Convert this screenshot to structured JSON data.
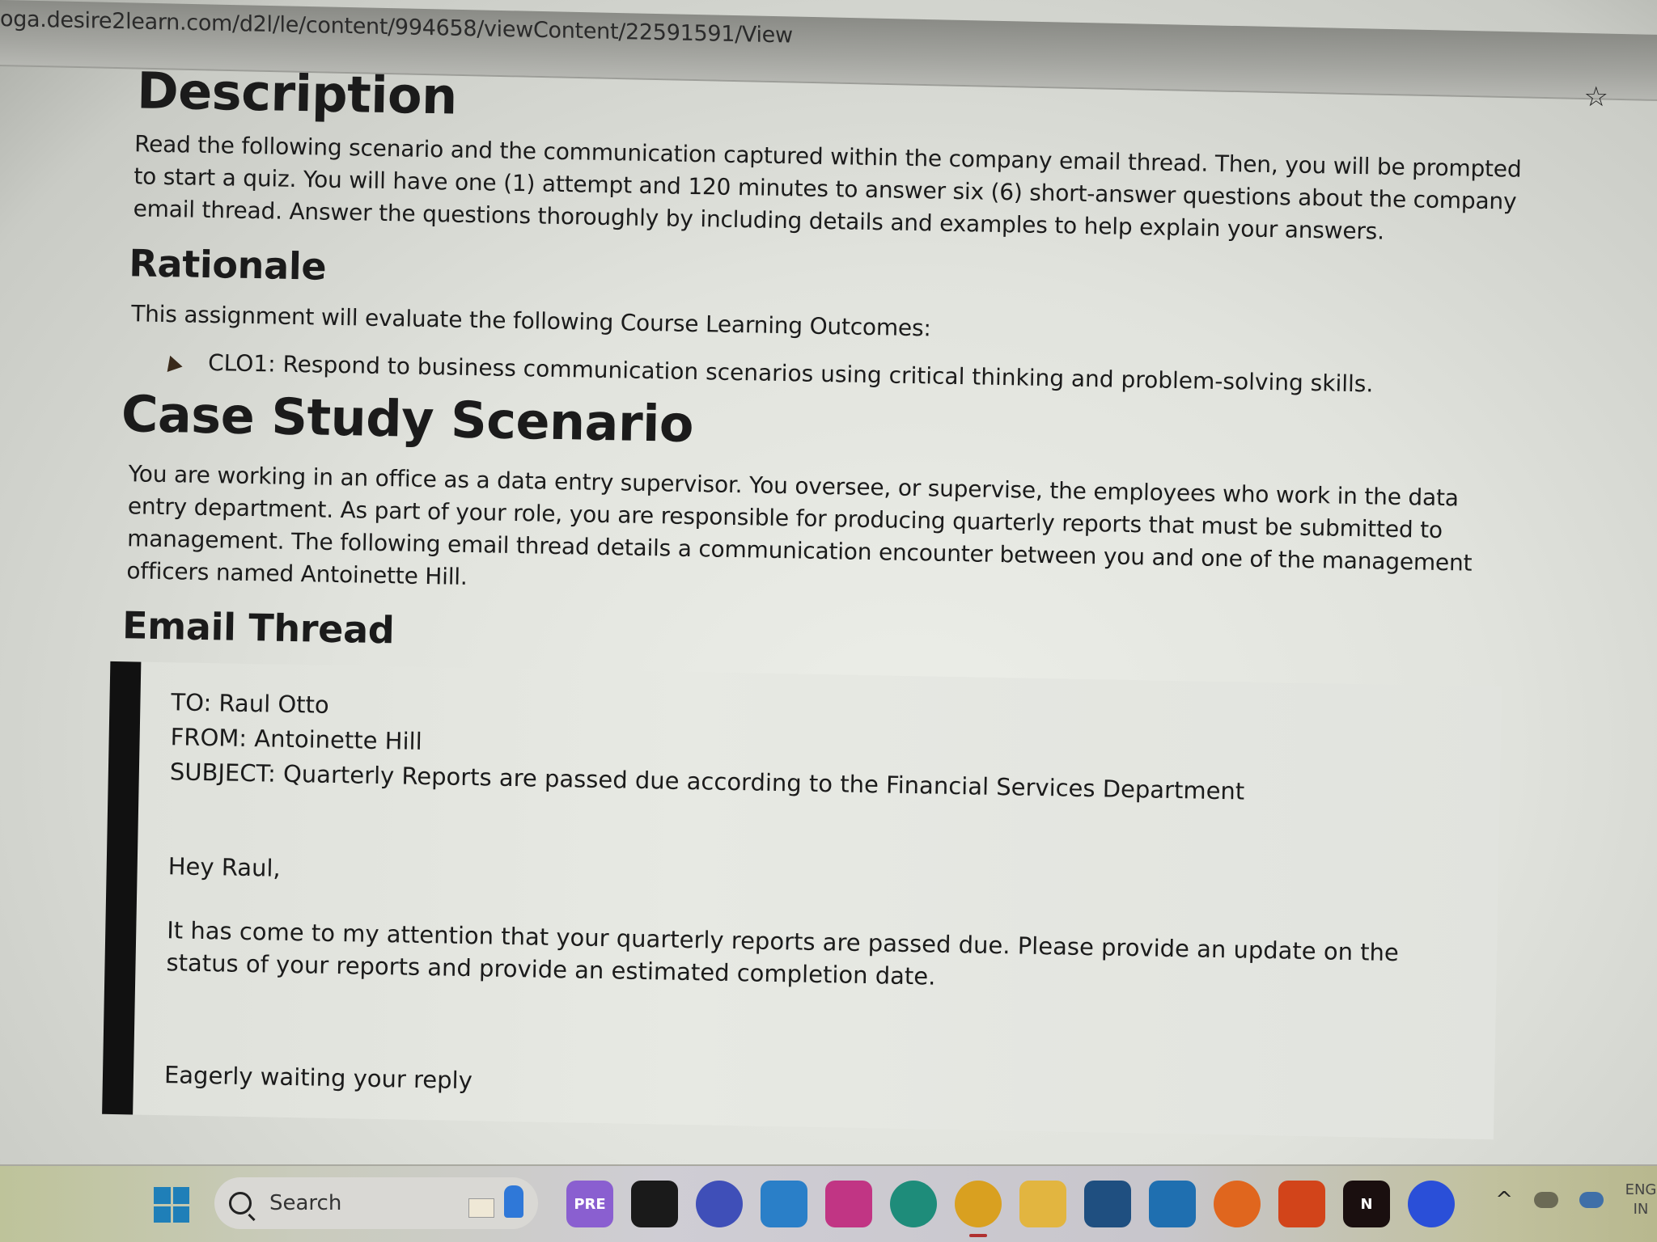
{
  "browser": {
    "url": "oga.desire2learn.com/d2l/le/content/994658/viewContent/22591591/View",
    "bookmark_icon": "star-icon"
  },
  "page": {
    "description": {
      "heading": "Description",
      "text": "Read the following scenario and the communication captured within the company email thread. Then, you will be prompted to start a quiz. You will have one (1) attempt and 120 minutes to answer six (6) short-answer questions about the company email thread. Answer the questions thoroughly by including details and examples to help explain your answers."
    },
    "rationale": {
      "heading": "Rationale",
      "intro": "This assignment will evaluate the following Course Learning Outcomes:",
      "outcomes": [
        "CLO1: Respond to business communication scenarios using critical thinking and problem-solving skills."
      ]
    },
    "case_study": {
      "heading": "Case Study Scenario",
      "text": "You are working in an office as a data entry supervisor. You oversee, or supervise, the employees who work in the data entry department. As part of your role, you are responsible for producing quarterly reports that must be submitted to management. The following email thread details a communication encounter between you and one of the management officers named Antoinette Hill."
    },
    "email_thread": {
      "heading": "Email Thread",
      "to": "TO: Raul Otto",
      "from": "FROM: Antoinette Hill",
      "subject": "SUBJECT: Quarterly Reports are passed due according to the Financial Services Department",
      "greeting": "Hey Raul,",
      "body": "It has come to my attention that your quarterly reports are passed due. Please provide an update on the status of your reports and provide an estimated completion date.",
      "signoff": "Eagerly waiting your reply"
    }
  },
  "taskbar": {
    "start_icon": "windows-start-icon",
    "search_label": "Search",
    "apps": [
      {
        "name": "copilot-pre-icon",
        "label": "PRE",
        "color": "#8a5fd0"
      },
      {
        "name": "task-view-icon",
        "label": "",
        "color": "#1a1a1a"
      },
      {
        "name": "meet-chat-icon",
        "label": "",
        "color": "#3f4fb8"
      },
      {
        "name": "mail-icon",
        "label": "",
        "color": "#2a7fc8"
      },
      {
        "name": "instagram-icon",
        "label": "",
        "color": "#c13584"
      },
      {
        "name": "edge-icon",
        "label": "",
        "color": "#1e8c7a"
      },
      {
        "name": "chrome-icon",
        "label": "",
        "color": "#d9a020",
        "active": true
      },
      {
        "name": "file-explorer-icon",
        "label": "",
        "color": "#e2b540"
      },
      {
        "name": "microsoft-store-icon",
        "label": "",
        "color": "#1f4f80"
      },
      {
        "name": "sync-app-icon",
        "label": "",
        "color": "#1f6fb0"
      },
      {
        "name": "firefox-icon",
        "label": "",
        "color": "#e0661e"
      },
      {
        "name": "vlc-icon",
        "label": "",
        "color": "#d2441a"
      },
      {
        "name": "netflix-icon",
        "label": "N",
        "color": "#1a0f0f"
      },
      {
        "name": "zoom-app-icon",
        "label": "",
        "color": "#2a4fd8"
      }
    ],
    "tray": {
      "chevron": "^",
      "lang_line1": "ENG",
      "lang_line2": "IN"
    }
  }
}
